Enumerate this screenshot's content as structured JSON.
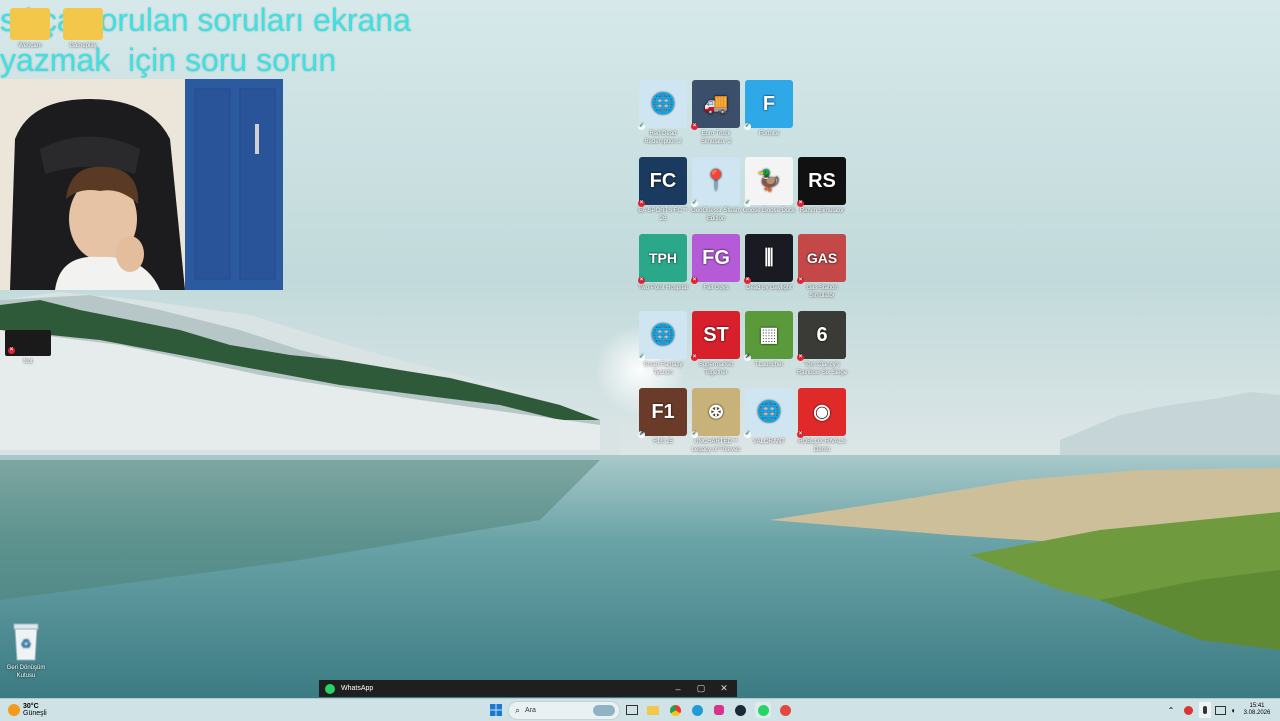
{
  "overlay": {
    "line1": "sıkça sorulan soruları ekrana",
    "line2": "yazmak  için soru sorun"
  },
  "top_left_icons": [
    {
      "label": "Webcam",
      "icon": "folder-icon"
    },
    {
      "label": "Gameplay",
      "icon": "folder-icon"
    }
  ],
  "left_icon": {
    "label": "Not",
    "icon": "dark-tile-icon"
  },
  "desktop_icons": [
    {
      "label": "Red Dead Redemption 2",
      "color": "#cfe6f2",
      "glyph": "🌐",
      "badge": "ok"
    },
    {
      "label": "Euro Truck Simulator 2",
      "color": "#3b4f6b",
      "glyph": "🚚",
      "badge": "err"
    },
    {
      "label": "Fortnite",
      "color": "#2fa8e8",
      "glyph": "F",
      "badge": "ok"
    },
    {
      "label": "EA SPORTS FC™ 26",
      "color": "#1b3a5f",
      "glyph": "FC",
      "badge": "err"
    },
    {
      "label": "GeoGuessr Steam Edition",
      "color": "#cfe6f2",
      "glyph": "📍",
      "badge": "ok"
    },
    {
      "label": "Goose Goose Duck",
      "color": "#f4f4f4",
      "glyph": "🦆",
      "badge": "ok"
    },
    {
      "label": "Ranch Simulator",
      "color": "#111111",
      "glyph": "RS",
      "badge": "err"
    },
    {
      "label": "Two Point Hospital",
      "color": "#2ba88a",
      "glyph": "TPH",
      "badge": "err"
    },
    {
      "label": "Fall Guys",
      "color": "#b65bd8",
      "glyph": "FG",
      "badge": "err"
    },
    {
      "label": "Dead by Daylight",
      "color": "#1a1a22",
      "glyph": "⫼",
      "badge": "err"
    },
    {
      "label": "Gas Station Simulator",
      "color": "#c44848",
      "glyph": "GAS",
      "badge": "err"
    },
    {
      "label": "Smart Fantasy Tycoon",
      "color": "#cfe6f2",
      "glyph": "🌐",
      "badge": "ok"
    },
    {
      "label": "Supermarket Together",
      "color": "#d8202c",
      "glyph": "ST",
      "badge": "err"
    },
    {
      "label": "TLauncher",
      "color": "#5a9a3a",
      "glyph": "▦",
      "badge": "sc"
    },
    {
      "label": "Tom Clancy's Rainbow Six Siege",
      "color": "#3a3a36",
      "glyph": "6",
      "badge": "err"
    },
    {
      "label": "F1® 25",
      "color": "#6b3b2a",
      "glyph": "F1",
      "badge": "sc"
    },
    {
      "label": "UNCHARTED™ Legacy of Thieves",
      "color": "#c8b27a",
      "glyph": "⊛",
      "badge": "ok"
    },
    {
      "label": "VALORANT",
      "color": "#cfe6f2",
      "glyph": "🌐",
      "badge": "ok"
    },
    {
      "label": "ROBLOX RIVALS Demo",
      "color": "#e02a2a",
      "glyph": "◉",
      "badge": "err"
    }
  ],
  "recycle_bin": {
    "label": "Geri Dönüşüm Kutusu"
  },
  "whatsapp": {
    "title": "WhatsApp",
    "minimize": "–",
    "maximize": "▢",
    "close": "✕"
  },
  "taskbar": {
    "weather_temp": "30°C",
    "weather_text": "Güneşli",
    "search_placeholder": "Ara",
    "time": "15:41",
    "date": "3.08.2026"
  }
}
